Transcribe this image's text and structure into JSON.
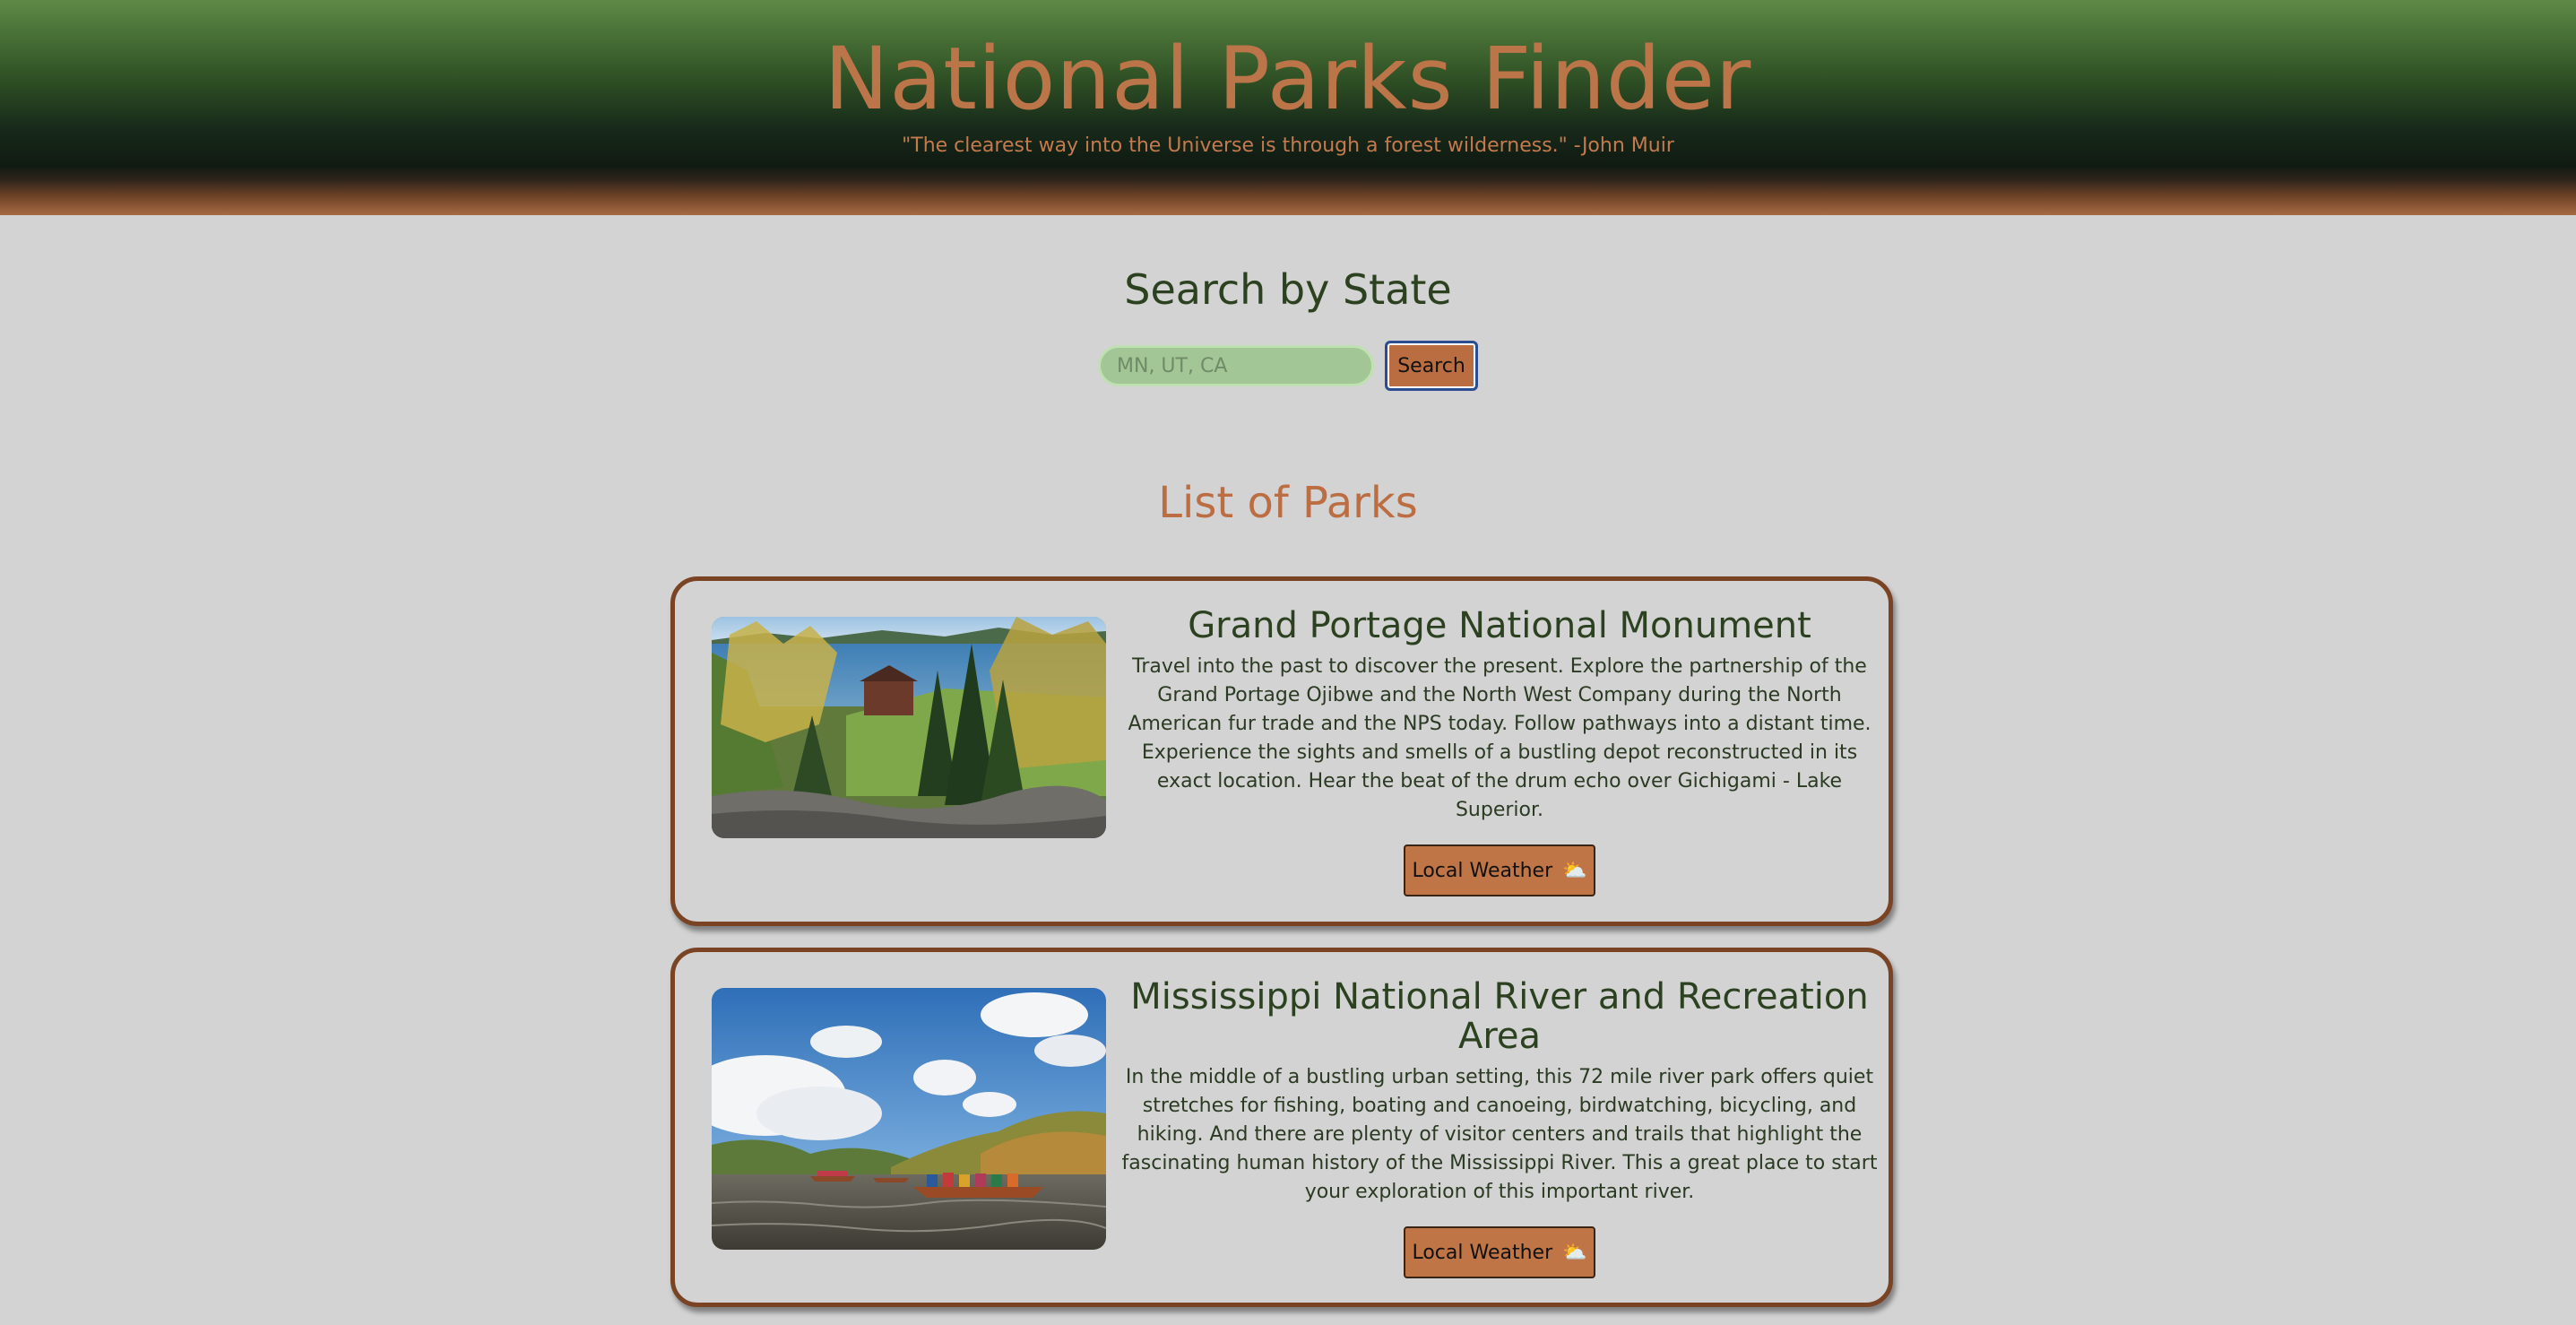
{
  "header": {
    "title": "National Parks Finder",
    "quote": "\"The clearest way into the Universe is through a forest wilderness.\" -John Muir"
  },
  "search": {
    "heading": "Search by State",
    "placeholder": "MN, UT, CA",
    "value": "",
    "button_label": "Search"
  },
  "list": {
    "heading": "List of Parks",
    "parks": [
      {
        "name": "Grand Portage National Monument",
        "description": "Travel into the past to discover the present. Explore the partnership of the Grand Portage Ojibwe and the North West Company during the North American fur trade and the NPS today. Follow pathways into a distant time. Experience the sights and smells of a bustling depot reconstructed in its exact location. Hear the beat of the drum echo over Gichigami - Lake Superior.",
        "weather_label": "Local Weather",
        "weather_icon": "⛅",
        "image_icon": "park-photo-forest-lake-icon"
      },
      {
        "name": "Mississippi National River and Recreation Area",
        "description": "In the middle of a bustling urban setting, this 72 mile river park offers quiet stretches for fishing, boating and canoeing, birdwatching, bicycling, and hiking. And there are plenty of visitor centers and trails that highlight the fascinating human history of the Mississippi River. This a great place to start your exploration of this important river.",
        "weather_label": "Local Weather",
        "weather_icon": "⛅",
        "image_icon": "park-photo-river-canoes-icon"
      }
    ]
  },
  "colors": {
    "brand_orange": "#bc7548",
    "forest_green": "#2b4120",
    "card_border": "#7a4323",
    "page_background": "#d3d3d3"
  }
}
